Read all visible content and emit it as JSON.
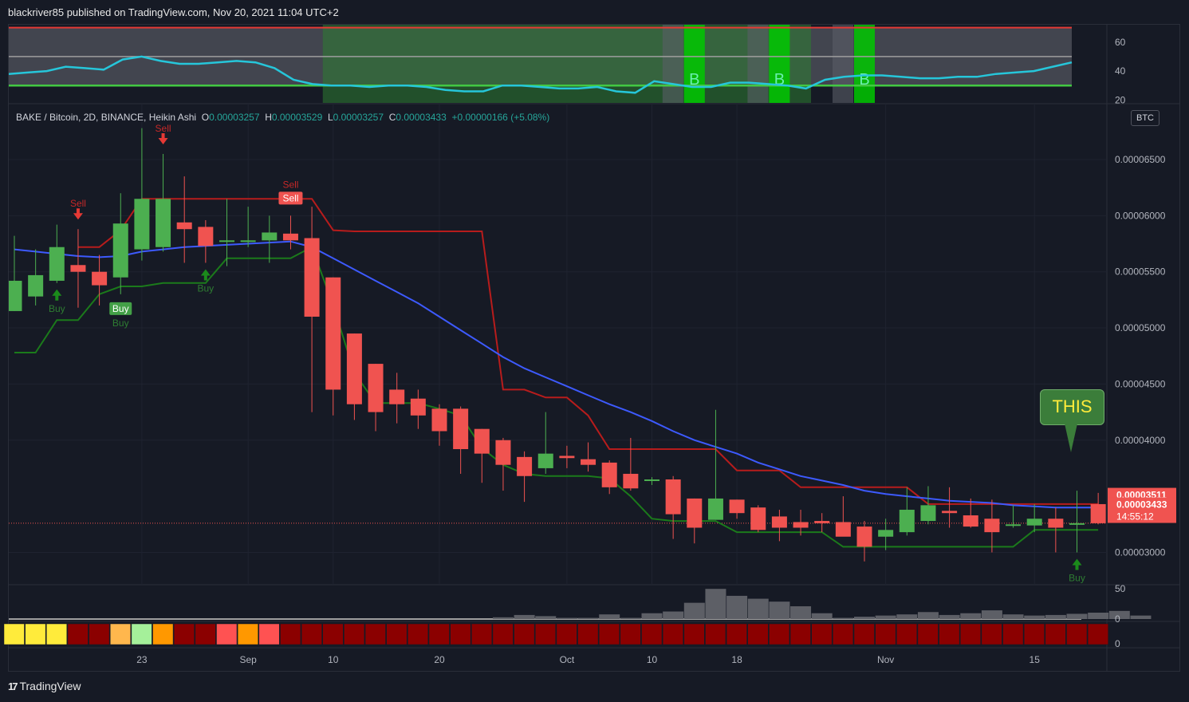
{
  "header": {
    "text": "blackriver85 published on TradingView.com, Nov 20, 2021 11:04 UTC+2"
  },
  "footer": {
    "brand": "TradingView"
  },
  "legend": {
    "symbol": "BAKE / Bitcoin, 2D, BINANCE, Heikin Ashi",
    "o_label": "O",
    "o": "0.00003257",
    "h_label": "H",
    "h": "0.00003529",
    "l_label": "L",
    "l": "0.00003257",
    "c_label": "C",
    "c": "0.00003433",
    "change": "+0.00000166 (+5.08%)"
  },
  "currency_tag": "BTC",
  "annotation": {
    "text": "THIS"
  },
  "price_labels": {
    "upper": "0.00003511",
    "current": "0.00003433",
    "countdown": "14:55:12"
  },
  "colors": {
    "up": "#4caf50",
    "down": "#f05350",
    "ma": "#3d5afe",
    "stop_down": "#b71c1c",
    "stop_up": "#1b7a1b",
    "rsi": "#26c6da",
    "buy": "#2e7d32",
    "sell": "#c62828"
  },
  "chart_data": {
    "type": "candlestick",
    "x_ticks": [
      {
        "label": "23",
        "index": 6
      },
      {
        "label": "Sep",
        "index": 11
      },
      {
        "label": "10",
        "index": 15
      },
      {
        "label": "20",
        "index": 20
      },
      {
        "label": "Oct",
        "index": 26
      },
      {
        "label": "10",
        "index": 30
      },
      {
        "label": "18",
        "index": 34
      },
      {
        "label": "Nov",
        "index": 41
      },
      {
        "label": "15",
        "index": 48
      }
    ],
    "y_ticks": [
      "0.00006500",
      "0.00006000",
      "0.00005500",
      "0.00005000",
      "0.00004500",
      "0.00004000",
      "0.00003000"
    ],
    "ylim": [
      2.63e-05,
      7.2e-05
    ],
    "candles": [
      {
        "o": 5.15,
        "h": 5.82,
        "l": 5.15,
        "c": 5.42
      },
      {
        "o": 5.28,
        "h": 5.7,
        "l": 5.2,
        "c": 5.47
      },
      {
        "o": 5.42,
        "h": 5.92,
        "l": 5.4,
        "c": 5.72
      },
      {
        "o": 5.56,
        "h": 5.88,
        "l": 5.18,
        "c": 5.5
      },
      {
        "o": 5.5,
        "h": 5.65,
        "l": 5.2,
        "c": 5.38
      },
      {
        "o": 5.45,
        "h": 6.2,
        "l": 5.3,
        "c": 5.93
      },
      {
        "o": 5.7,
        "h": 6.78,
        "l": 5.6,
        "c": 6.15
      },
      {
        "o": 5.72,
        "h": 6.55,
        "l": 5.68,
        "c": 6.15
      },
      {
        "o": 5.94,
        "h": 6.35,
        "l": 5.58,
        "c": 5.88
      },
      {
        "o": 5.9,
        "h": 5.96,
        "l": 5.58,
        "c": 5.73
      },
      {
        "o": 5.78,
        "h": 6.15,
        "l": 5.55,
        "c": 5.78
      },
      {
        "o": 5.78,
        "h": 6.08,
        "l": 5.72,
        "c": 5.78
      },
      {
        "o": 5.78,
        "h": 6.0,
        "l": 5.58,
        "c": 5.85
      },
      {
        "o": 5.84,
        "h": 6.0,
        "l": 5.7,
        "c": 5.78
      },
      {
        "o": 5.8,
        "h": 6.08,
        "l": 4.25,
        "c": 5.1
      },
      {
        "o": 5.45,
        "h": 5.45,
        "l": 4.22,
        "c": 4.45
      },
      {
        "o": 4.95,
        "h": 4.95,
        "l": 4.18,
        "c": 4.32
      },
      {
        "o": 4.68,
        "h": 4.68,
        "l": 4.08,
        "c": 4.25
      },
      {
        "o": 4.45,
        "h": 4.6,
        "l": 4.15,
        "c": 4.32
      },
      {
        "o": 4.37,
        "h": 4.45,
        "l": 4.1,
        "c": 4.22
      },
      {
        "o": 4.28,
        "h": 4.32,
        "l": 3.95,
        "c": 4.08
      },
      {
        "o": 4.28,
        "h": 4.3,
        "l": 3.7,
        "c": 3.92
      },
      {
        "o": 4.1,
        "h": 4.1,
        "l": 3.62,
        "c": 3.88
      },
      {
        "o": 4.0,
        "h": 4.02,
        "l": 3.55,
        "c": 3.78
      },
      {
        "o": 3.85,
        "h": 3.9,
        "l": 3.45,
        "c": 3.68
      },
      {
        "o": 3.75,
        "h": 4.25,
        "l": 3.7,
        "c": 3.88
      },
      {
        "o": 3.86,
        "h": 3.95,
        "l": 3.75,
        "c": 3.84
      },
      {
        "o": 3.83,
        "h": 3.98,
        "l": 3.72,
        "c": 3.78
      },
      {
        "o": 3.8,
        "h": 3.82,
        "l": 3.52,
        "c": 3.58
      },
      {
        "o": 3.7,
        "h": 4.02,
        "l": 3.55,
        "c": 3.57
      },
      {
        "o": 3.65,
        "h": 3.67,
        "l": 3.6,
        "c": 3.65
      },
      {
        "o": 3.65,
        "h": 3.68,
        "l": 3.12,
        "c": 3.34
      },
      {
        "o": 3.48,
        "h": 3.48,
        "l": 3.08,
        "c": 3.22
      },
      {
        "o": 3.29,
        "h": 4.27,
        "l": 3.29,
        "c": 3.48
      },
      {
        "o": 3.47,
        "h": 3.47,
        "l": 3.3,
        "c": 3.35
      },
      {
        "o": 3.4,
        "h": 3.42,
        "l": 3.18,
        "c": 3.2
      },
      {
        "o": 3.32,
        "h": 3.38,
        "l": 3.1,
        "c": 3.22
      },
      {
        "o": 3.27,
        "h": 3.38,
        "l": 3.15,
        "c": 3.22
      },
      {
        "o": 3.28,
        "h": 3.35,
        "l": 3.18,
        "c": 3.26
      },
      {
        "o": 3.27,
        "h": 3.5,
        "l": 3.18,
        "c": 3.14
      },
      {
        "o": 3.23,
        "h": 3.28,
        "l": 2.92,
        "c": 3.05
      },
      {
        "o": 3.14,
        "h": 3.3,
        "l": 3.02,
        "c": 3.2
      },
      {
        "o": 3.18,
        "h": 3.58,
        "l": 3.15,
        "c": 3.38
      },
      {
        "o": 3.28,
        "h": 3.59,
        "l": 3.25,
        "c": 3.42
      },
      {
        "o": 3.37,
        "h": 3.58,
        "l": 3.22,
        "c": 3.35
      },
      {
        "o": 3.33,
        "h": 3.48,
        "l": 3.22,
        "c": 3.23
      },
      {
        "o": 3.3,
        "h": 3.47,
        "l": 3.0,
        "c": 3.18
      },
      {
        "o": 3.25,
        "h": 3.42,
        "l": 3.22,
        "c": 3.25
      },
      {
        "o": 3.24,
        "h": 3.43,
        "l": 3.18,
        "c": 3.3
      },
      {
        "o": 3.3,
        "h": 3.4,
        "l": 3.0,
        "c": 3.22
      },
      {
        "o": 3.26,
        "h": 3.55,
        "l": 3.0,
        "c": 3.26
      },
      {
        "o": 3.43,
        "h": 3.53,
        "l": 3.25,
        "c": 3.26
      }
    ],
    "ma_line": [
      5.7,
      5.68,
      5.66,
      5.64,
      5.63,
      5.64,
      5.68,
      5.7,
      5.72,
      5.73,
      5.74,
      5.75,
      5.76,
      5.77,
      5.72,
      5.62,
      5.52,
      5.42,
      5.32,
      5.22,
      5.1,
      4.98,
      4.86,
      4.74,
      4.64,
      4.56,
      4.48,
      4.4,
      4.32,
      4.25,
      4.17,
      4.08,
      4.0,
      3.94,
      3.88,
      3.8,
      3.74,
      3.68,
      3.64,
      3.6,
      3.55,
      3.52,
      3.5,
      3.48,
      3.46,
      3.45,
      3.44,
      3.42,
      3.41,
      3.4,
      3.4,
      3.4
    ],
    "stop_upper": [
      null,
      null,
      null,
      5.72,
      5.72,
      5.87,
      6.15,
      6.15,
      6.15,
      6.15,
      6.15,
      6.15,
      6.15,
      6.15,
      6.15,
      5.87,
      5.86,
      5.86,
      5.86,
      5.86,
      5.86,
      5.86,
      5.86,
      4.45,
      4.45,
      4.38,
      4.38,
      4.22,
      3.92,
      3.92,
      3.92,
      3.92,
      3.92,
      3.92,
      3.73,
      3.73,
      3.73,
      3.58,
      3.58,
      3.58,
      3.58,
      3.58,
      3.58,
      3.43,
      3.43,
      3.43,
      3.43,
      3.43,
      3.43,
      3.43,
      3.43,
      3.43
    ],
    "stop_lower": [
      4.78,
      4.78,
      5.07,
      5.07,
      5.3,
      5.37,
      5.37,
      5.4,
      5.4,
      5.4,
      5.62,
      5.62,
      5.62,
      5.62,
      5.72,
      5.2,
      4.6,
      4.33,
      4.33,
      4.33,
      4.28,
      4.22,
      3.93,
      3.78,
      3.7,
      3.68,
      3.68,
      3.68,
      3.66,
      3.5,
      3.3,
      3.28,
      3.28,
      3.28,
      3.18,
      3.18,
      3.18,
      3.18,
      3.18,
      3.05,
      3.05,
      3.05,
      3.05,
      3.05,
      3.05,
      3.05,
      3.05,
      3.05,
      3.2,
      3.2,
      3.2,
      3.2
    ],
    "signals": [
      {
        "index": 3,
        "type": "sell",
        "label": "Sell",
        "style": "text"
      },
      {
        "index": 7,
        "type": "sell",
        "label": "Sell",
        "style": "text"
      },
      {
        "index": 13,
        "type": "sell",
        "label": "Sell",
        "style": "box"
      },
      {
        "index": 2,
        "type": "buy",
        "label": "Buy",
        "style": "text"
      },
      {
        "index": 5,
        "type": "buy",
        "label": "Buy",
        "style": "box"
      },
      {
        "index": 9,
        "type": "buy",
        "label": "Buy",
        "style": "text"
      },
      {
        "index": 50,
        "type": "buy",
        "label": "Buy",
        "style": "text"
      }
    ],
    "rsi_panel": {
      "y_ticks": [
        "60",
        "40",
        "20"
      ],
      "ylim": [
        18,
        72
      ],
      "upper_band": 70,
      "middle": 50,
      "lower_band": 30,
      "values": [
        38,
        39,
        40,
        43,
        42,
        41,
        48,
        50,
        47,
        45,
        45,
        46,
        47,
        46,
        42,
        34,
        31,
        30,
        30,
        29,
        30,
        30,
        29,
        27,
        26,
        26,
        30,
        30,
        29,
        28,
        28,
        29,
        26,
        25,
        33,
        31,
        29,
        29,
        32,
        32,
        31,
        30,
        28,
        34,
        36,
        37,
        37,
        36,
        35,
        35,
        36,
        36,
        38,
        39,
        40,
        43,
        46
      ],
      "bg_green_range": [
        15,
        37
      ],
      "b_bars": [
        32,
        36,
        40
      ],
      "b_label": "B"
    },
    "volume_panel": {
      "y_ticks": [
        "50",
        "0"
      ],
      "ylim": [
        0,
        50
      ],
      "values": [
        1,
        1,
        1,
        1,
        1,
        1,
        1,
        1,
        1,
        1,
        1,
        1,
        1,
        1,
        1,
        1,
        1,
        1,
        1,
        1,
        1,
        1,
        1,
        3,
        7,
        5,
        2,
        2,
        8,
        2,
        10,
        13,
        28,
        52,
        40,
        35,
        30,
        22,
        10,
        2,
        4,
        6,
        8,
        12,
        7,
        10,
        15,
        8,
        6,
        7,
        9,
        11,
        14,
        6
      ],
      "max_value": 55
    },
    "heat_strip": {
      "y_ticks": [
        "0"
      ],
      "colors": [
        "#ffeb3b",
        "#ffeb3b",
        "#ffeb3b",
        "#8b0000",
        "#8b0000",
        "#ffb74d",
        "#a5f09a",
        "#ff9800",
        "#8b0000",
        "#8b0000",
        "#ff5252",
        "#ff9800",
        "#ff5252",
        "#8b0000",
        "#8b0000",
        "#8b0000",
        "#8b0000",
        "#8b0000",
        "#8b0000",
        "#8b0000",
        "#8b0000",
        "#8b0000",
        "#8b0000",
        "#8b0000",
        "#8b0000",
        "#8b0000",
        "#8b0000",
        "#8b0000",
        "#8b0000",
        "#8b0000",
        "#8b0000",
        "#8b0000",
        "#8b0000",
        "#8b0000",
        "#8b0000",
        "#8b0000",
        "#8b0000",
        "#8b0000",
        "#8b0000",
        "#8b0000",
        "#8b0000",
        "#8b0000",
        "#8b0000",
        "#8b0000",
        "#8b0000",
        "#8b0000",
        "#8b0000",
        "#8b0000",
        "#8b0000",
        "#8b0000",
        "#8b0000",
        "#8b0000"
      ]
    }
  }
}
